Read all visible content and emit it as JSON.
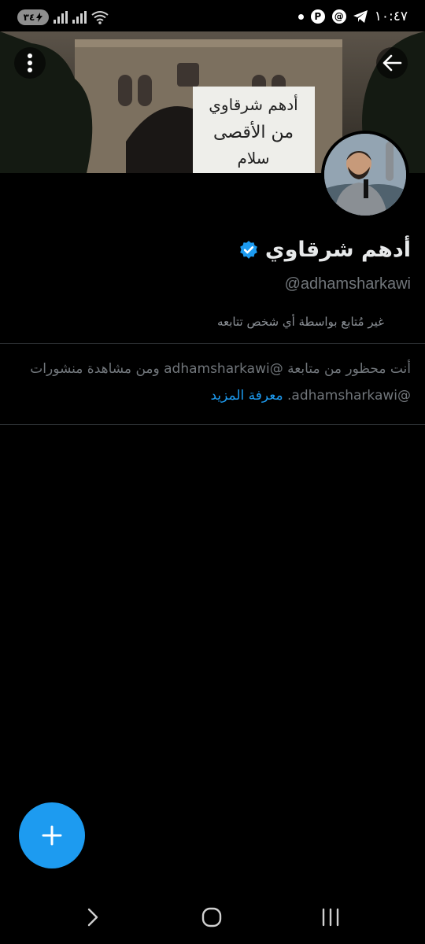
{
  "status_bar": {
    "battery": "٣٤",
    "time": "١٠:٤٧"
  },
  "profile": {
    "name": "أدهم شرقاوي",
    "handle": "@adhamsharkawi",
    "follow_status": "غير مُتابع بواسطة أي شخص تتابعه",
    "verified": true
  },
  "banner": {
    "sign_text": [
      "أدهم شرقاوي",
      "من الأقصى",
      "سلام"
    ]
  },
  "blocked_notice": {
    "text": "أنت محظور من متابعة @adhamsharkawi ومن مشاهدة منشورات @adhamsharkawi.",
    "learn_more": "معرفة المزيد"
  },
  "colors": {
    "accent": "#1d9bf0",
    "background": "#000000",
    "secondary_text": "#71767b"
  },
  "icons": {
    "back": "arrow-left-icon",
    "more": "more-vertical-icon",
    "verified": "verified-badge-icon",
    "compose": "plus-icon"
  }
}
